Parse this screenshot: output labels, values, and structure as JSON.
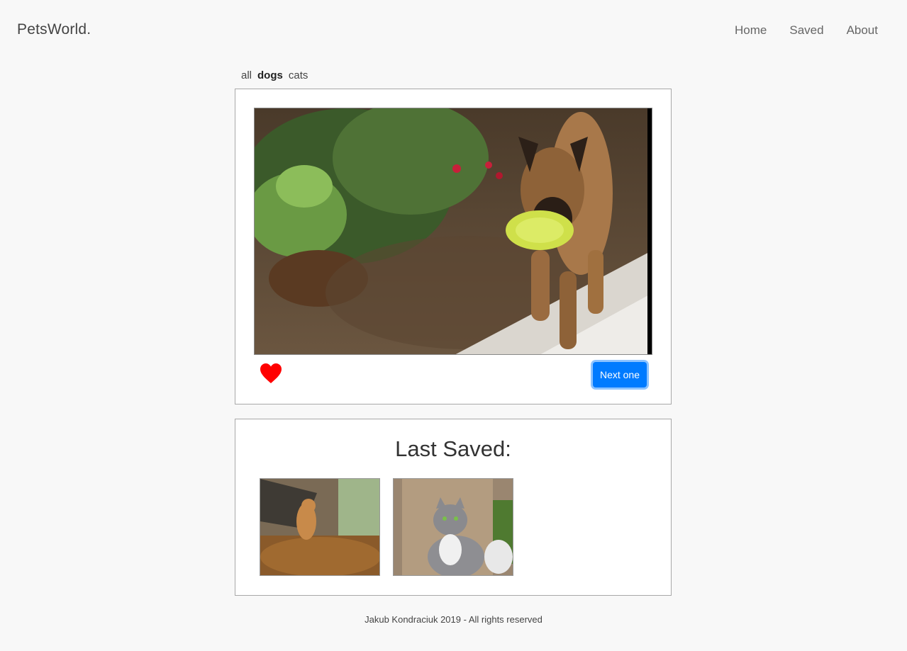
{
  "navbar": {
    "brand": "PetsWorld.",
    "links": [
      "Home",
      "Saved",
      "About"
    ]
  },
  "filters": {
    "items": [
      "all",
      "dogs",
      "cats"
    ],
    "active": "dogs"
  },
  "main_card": {
    "photo_icon": "dog-photo",
    "favorite_icon": "heart-icon",
    "next_label": "Next one"
  },
  "saved": {
    "title": "Last Saved:",
    "thumbnails": [
      "dog-photo",
      "cat-photo"
    ]
  },
  "footer": {
    "text": "Jakub Kondraciuk 2019 - All rights reserved"
  },
  "colors": {
    "accent": "#007bff",
    "heart": "#ff0000",
    "background": "#f8f8f8"
  }
}
